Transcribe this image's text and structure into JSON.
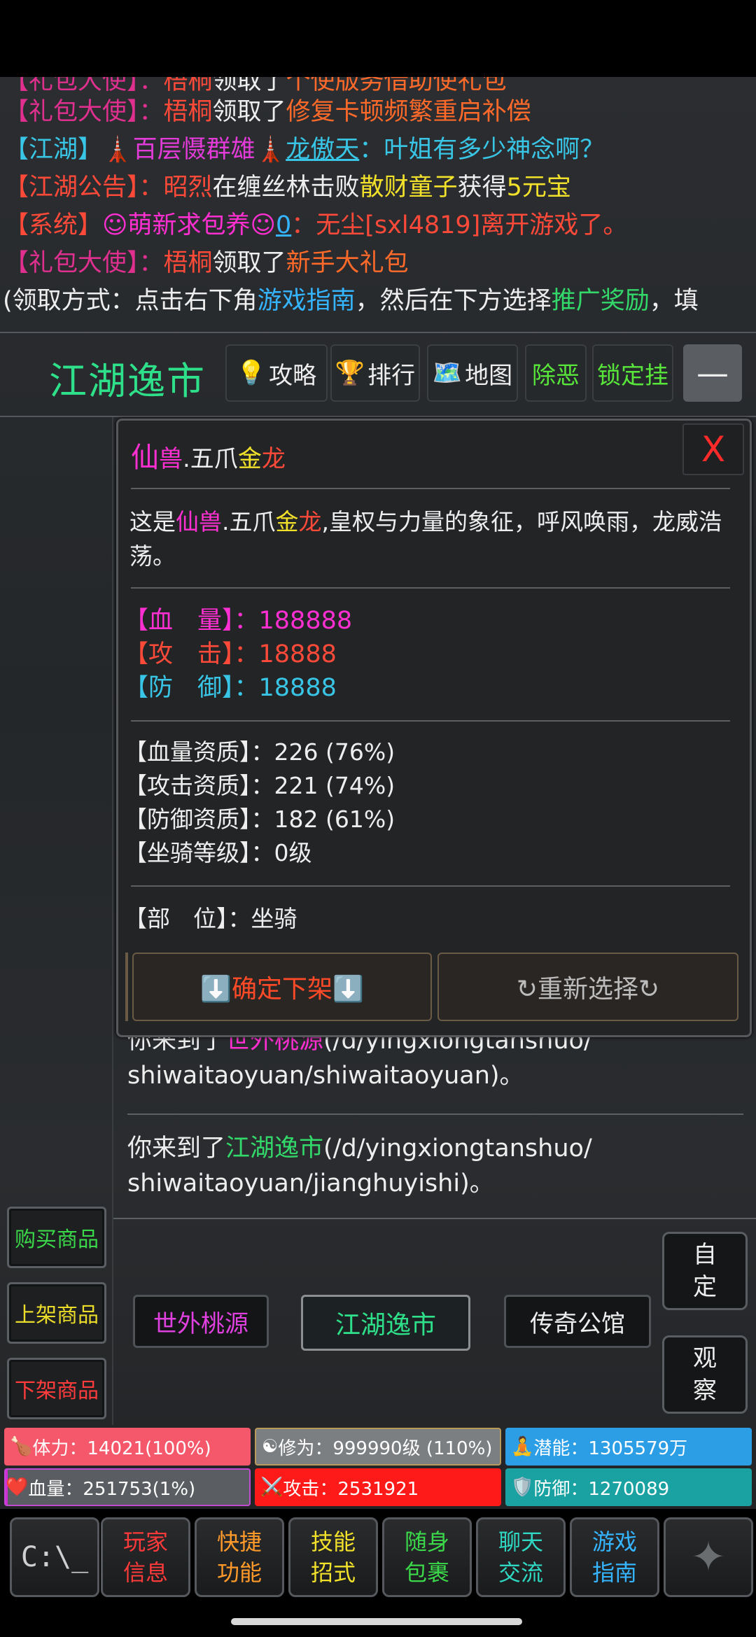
{
  "chat": {
    "line0": {
      "tag": "【礼包大使】",
      "sep": "：",
      "who": "梧桐",
      "act": "领取了",
      "item": "个使版务借助使礼包"
    },
    "line1": {
      "tag": "【礼包大使】",
      "sep": "：",
      "who": "梧桐",
      "act": "领取了",
      "item": "修复卡顿频繁重启补偿"
    },
    "line2": {
      "tag": "【江湖】",
      "title": "🗼百层慑群雄🗼",
      "who": "龙傲天",
      "text": "：叶姐有多少神念啊？"
    },
    "line3": {
      "tag": "【江湖公告】",
      "sep": "：",
      "who": "昭烈",
      "text1": "在缠丝林击败",
      "boss": "散财童子",
      "text2": "获得",
      "reward": "5元宝"
    },
    "line4": {
      "tag": "【系统】",
      "title": "☺萌新求包养☺",
      "who": "0",
      "text": "：无尘[sxl4819]离开游戏了。"
    },
    "line5": {
      "tag": "【礼包大使】",
      "sep": "：",
      "who": "梧桐",
      "act": "领取了",
      "item": "新手大礼包"
    },
    "line6": {
      "t1": "(领取方式：点击右下角",
      "link1": "游戏指南",
      "t2": "，然后在下方选择",
      "link2": "推广奖励",
      "t3": "，填"
    }
  },
  "titlebar": {
    "location": "江湖逸市",
    "buttons": [
      {
        "icon": "💡",
        "label": "攻略"
      },
      {
        "icon": "🏆",
        "label": "排行"
      },
      {
        "icon": "🗺️",
        "label": "地图"
      },
      {
        "icon": "",
        "label": "除恶"
      },
      {
        "icon": "",
        "label": "锁定挂"
      }
    ],
    "minimize": "—"
  },
  "modal": {
    "title_a": "仙",
    "title_b": "兽",
    "title_c": ".五爪",
    "title_d": "金",
    "title_e": "龙",
    "close": "X",
    "desc_pre": "这是",
    "desc_post": ",皇权与力量的象征，呼风唤雨，龙威浩荡。",
    "hp_label": "【血　量】：",
    "hp": "188888",
    "atk_label": "【攻　击】：",
    "atk": "18888",
    "def_label": "【防　御】：",
    "def": "18888",
    "q_hp": "【血量资质】：226 (76%)",
    "q_atk": "【攻击资质】：221 (74%)",
    "q_def": "【防御资质】：182 (61%)",
    "mount_level": "【坐骑等级】：0级",
    "slot": "【部　位】：坐骑",
    "confirm": "⬇️确定下架⬇️",
    "reselect": "↻重新选择↻"
  },
  "log": {
    "l1_pre": "你来到了",
    "l1_place": "世外桃源",
    "l1_path": "(/d/yingxiongtanshuo/",
    "l1_path2": "shiwaitaoyuan/shiwaitaoyuan)。",
    "l2_pre": "你来到了",
    "l2_place": "江湖逸市",
    "l2_path": "(/d/yingxiongtanshuo/",
    "l2_path2": "shiwaitaoyuan/jianghuyishi)。"
  },
  "side": {
    "buy": "购买商品",
    "list": "上架商品",
    "delist": "下架商品"
  },
  "nav": {
    "west": "世外桃源",
    "here": "江湖逸市",
    "east": "传奇公馆"
  },
  "right": {
    "custom": "自定",
    "observe": "观察"
  },
  "stats": {
    "stamina": "体力：14021(100%)",
    "cultivation": "修为：999990级 (110%)",
    "potential": "潜能：1305579万",
    "hp": "血量：251753(1%)",
    "attack": "攻击：2531921",
    "defense": "防御：1270089",
    "stamina_pct": 100,
    "hp_pct": 1
  },
  "bottom": [
    {
      "l1": "玩家",
      "l2": "信息",
      "color": "#ff3a3a"
    },
    {
      "l1": "快捷",
      "l2": "功能",
      "color": "#ff9a2a"
    },
    {
      "l1": "技能",
      "l2": "招式",
      "color": "#f2e12b"
    },
    {
      "l1": "随身",
      "l2": "包裹",
      "color": "#3bd84a"
    },
    {
      "l1": "聊天",
      "l2": "交流",
      "color": "#2fd8c2"
    },
    {
      "l1": "游戏",
      "l2": "指南",
      "color": "#35b4ff"
    }
  ],
  "terminal_icon": "C:\\_",
  "colors": {
    "accent_green": "#2fe08a",
    "danger": "#ff2a2a"
  }
}
